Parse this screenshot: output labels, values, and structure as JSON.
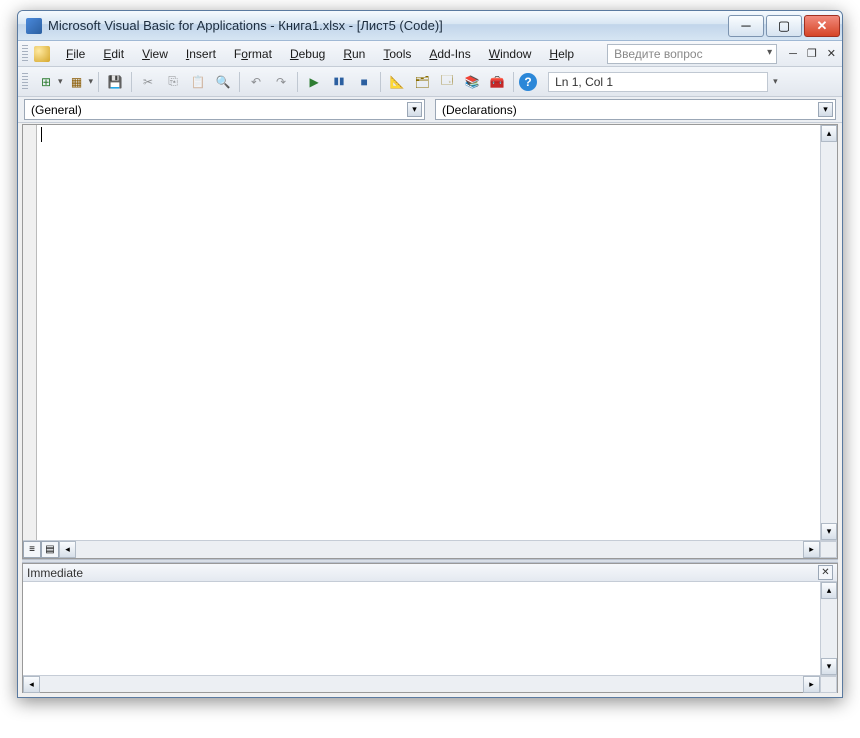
{
  "title": "Microsoft Visual Basic for Applications - Книга1.xlsx - [Лист5 (Code)]",
  "menu": {
    "file": "File",
    "edit": "Edit",
    "view": "View",
    "insert": "Insert",
    "format": "Format",
    "debug": "Debug",
    "run": "Run",
    "tools": "Tools",
    "addins": "Add-Ins",
    "window": "Window",
    "help": "Help"
  },
  "search_placeholder": "Введите вопрос",
  "status": "Ln 1, Col 1",
  "combo_left": "(General)",
  "combo_right": "(Declarations)",
  "immediate_label": "Immediate",
  "icons": {
    "excel": "⊞",
    "form": "▦",
    "save": "💾",
    "cut": "✂",
    "copy": "⎘",
    "paste": "📋",
    "find": "🔍",
    "undo": "↶",
    "redo": "↷",
    "run": "▶",
    "break": "▮▮",
    "reset": "■",
    "design": "📐",
    "project": "🗂",
    "props": "🗔",
    "objbrowser": "📚",
    "toolbox": "🧰",
    "help": "?"
  }
}
